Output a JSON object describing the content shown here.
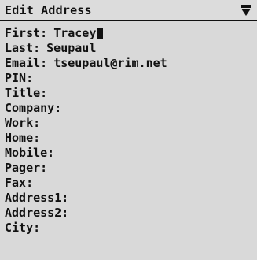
{
  "header": {
    "title": "Edit Address",
    "menu_icon": "menu-down-arrow-icon"
  },
  "fields": [
    {
      "label": "First:",
      "value": "Tracey"
    },
    {
      "label": "Last:",
      "value": "Seupaul"
    },
    {
      "label": "Email:",
      "value": "tseupaul@rim.net"
    },
    {
      "label": "PIN:",
      "value": ""
    },
    {
      "label": "Title:",
      "value": ""
    },
    {
      "label": "Company:",
      "value": ""
    },
    {
      "label": "Work:",
      "value": ""
    },
    {
      "label": "Home:",
      "value": ""
    },
    {
      "label": "Mobile:",
      "value": ""
    },
    {
      "label": "Pager:",
      "value": ""
    },
    {
      "label": "Fax:",
      "value": ""
    },
    {
      "label": "Address1:",
      "value": ""
    },
    {
      "label": "Address2:",
      "value": ""
    },
    {
      "label": "City:",
      "value": ""
    }
  ],
  "colors": {
    "background": "#d9d9d9",
    "text": "#111111"
  }
}
